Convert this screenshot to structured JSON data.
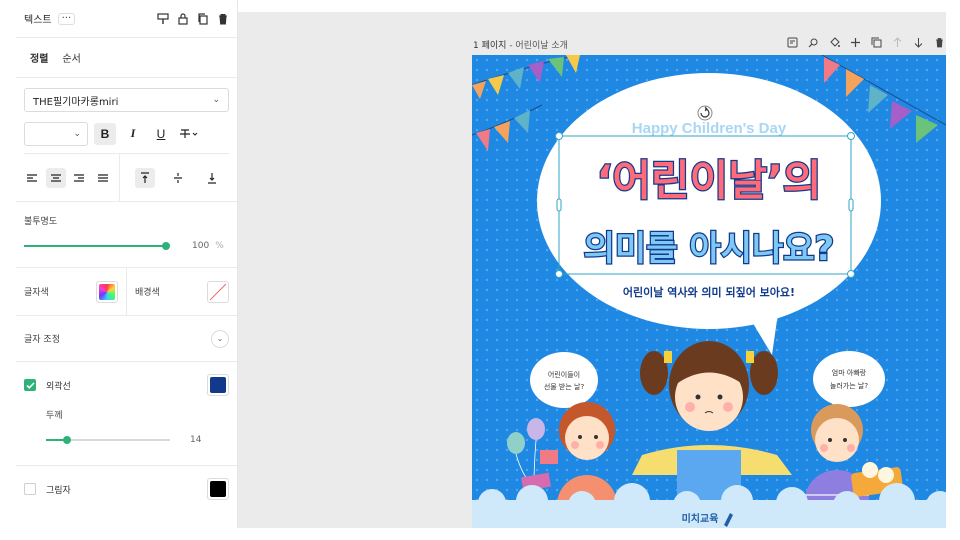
{
  "panel": {
    "title": "텍스트",
    "more": "···",
    "tabs": [
      "정렬",
      "순서"
    ],
    "font_name": "THE필기마카롱miri",
    "size_value": "",
    "opacity_label": "불투명도",
    "opacity_value": "100",
    "opacity_unit": "%",
    "opacity_fraction": 1.0,
    "text_color_label": "글자색",
    "bg_color_label": "배경색",
    "adjust_label": "글자 조정",
    "outline_label": "외곽선",
    "outline_checked": true,
    "outline_color": "#123a8c",
    "thickness_label": "두께",
    "thickness_value": "14",
    "thickness_fraction": 0.17,
    "shadow_label": "그림자",
    "shadow_checked": false,
    "shadow_color": "#000000"
  },
  "workspace": {
    "page_number": "1 페이지",
    "page_name": "- 어린이날 소개"
  },
  "poster": {
    "top_text": "Happy Children's Day",
    "title_line1": "‘어린이날’의",
    "title_line2": "의미를 아시나요?",
    "subtitle": "어린이날 역사와 의미 되짚어 보아요!",
    "bubble_left": [
      "어린이들이",
      "선물 받는 날?"
    ],
    "bubble_right": [
      "엄마 아빠랑",
      "놀러가는 날?"
    ],
    "brand": "미치교육"
  },
  "colors": {
    "accent": "#2fb27a",
    "poster_bg": "#1e88e3",
    "title_fill": "#ff6b7a",
    "title_outline": "#123a8c",
    "title2_fill": "#7ec8f5"
  }
}
